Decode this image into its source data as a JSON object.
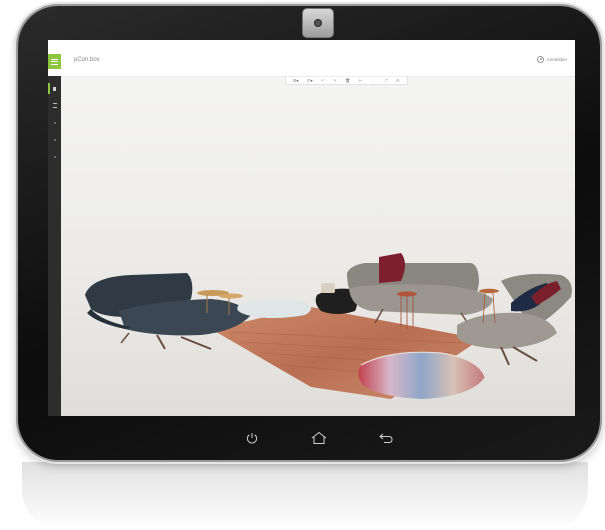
{
  "app": {
    "title": "pCon.box",
    "user_name": "Anmelden"
  },
  "toolbar": {
    "tools": [
      {
        "icon": "view-icon",
        "glyph": "⊞▾"
      },
      {
        "icon": "camera-icon",
        "glyph": "⊡▾"
      },
      {
        "icon": "undo-icon",
        "glyph": "↶"
      },
      {
        "icon": "redo-icon",
        "glyph": "↷"
      },
      {
        "icon": "delete-icon",
        "glyph": "🗑"
      },
      {
        "icon": "measure-icon",
        "glyph": "⊢"
      },
      {
        "icon": "snap-icon",
        "glyph": "⋮"
      },
      {
        "icon": "share-icon",
        "glyph": "⤴"
      },
      {
        "icon": "settings-icon",
        "glyph": "⚙"
      }
    ]
  },
  "sidebar": {
    "items": [
      {
        "name": "sidebar-item-insert",
        "active": true
      },
      {
        "name": "sidebar-item-catalog",
        "active": false
      },
      {
        "name": "sidebar-item-layers",
        "active": false
      },
      {
        "name": "sidebar-item-materials",
        "active": false
      },
      {
        "name": "sidebar-item-export",
        "active": false
      }
    ]
  },
  "device": {
    "nav_buttons": [
      "power-icon",
      "home-icon",
      "back-icon"
    ]
  },
  "colors": {
    "accent": "#8dc63f",
    "sidebar": "#2d2d2d",
    "bezel": "#111111"
  }
}
